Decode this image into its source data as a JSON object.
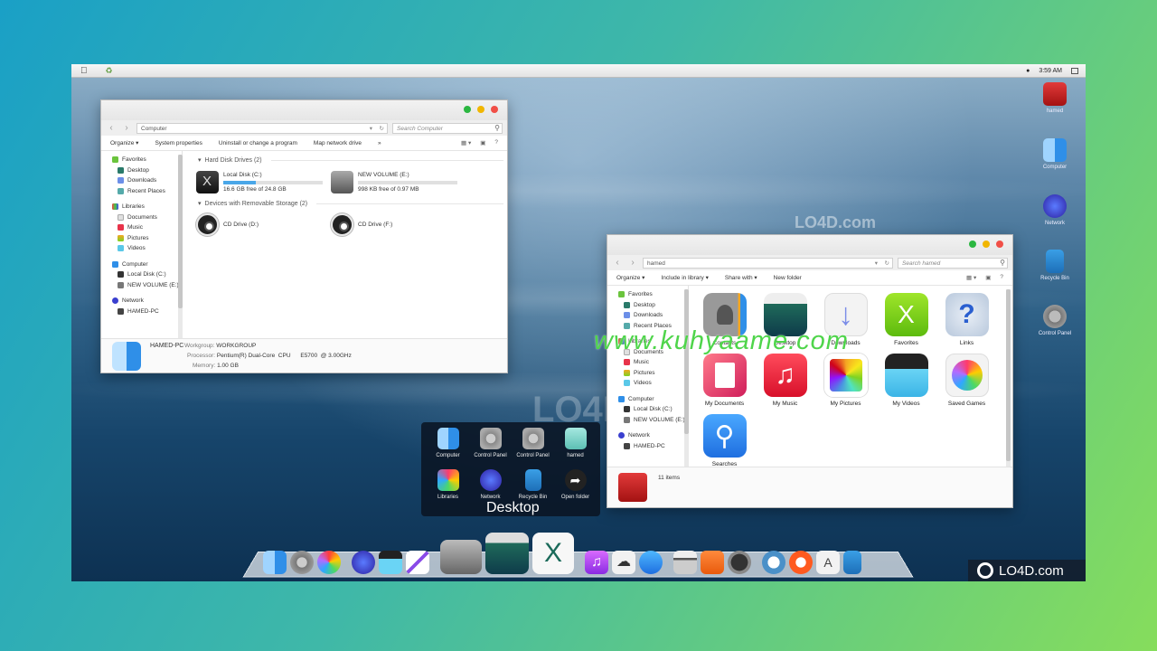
{
  "menubar": {
    "apple_icon": "apple-icon",
    "tray_icon": "recycle-icon",
    "clock": "3:59 AM"
  },
  "window_computer": {
    "address": "Computer",
    "search_placeholder": "Search Computer",
    "commands": [
      "Organize",
      "System properties",
      "Uninstall or change a program",
      "Map network drive"
    ],
    "more_commands": "»",
    "sidebar": {
      "favorites": "Favorites",
      "favorites_items": [
        "Desktop",
        "Downloads",
        "Recent Places"
      ],
      "libraries": "Libraries",
      "libraries_items": [
        "Documents",
        "Music",
        "Pictures",
        "Videos"
      ],
      "computer": "Computer",
      "computer_items": [
        "Local Disk (C:)",
        "NEW VOLUME (E:)"
      ],
      "network": "Network",
      "network_items": [
        "HAMED-PC"
      ]
    },
    "sections": {
      "hdd": "Hard Disk Drives (2)",
      "removable": "Devices with Removable Storage (2)"
    },
    "drives": [
      {
        "name": "Local Disk (C:)",
        "free": "16.6 GB free of 24.8 GB",
        "used_fraction": 0.33
      },
      {
        "name": "NEW VOLUME (E:)",
        "free": "998 KB free of 0.97 MB",
        "used_fraction": 0.0
      }
    ],
    "cd_drives": [
      "CD Drive (D:)",
      "CD Drive (F:)"
    ],
    "details": {
      "pc_name": "HAMED-PC",
      "workgroup_label": "Workgroup:",
      "workgroup": "WORKGROUP",
      "processor_label": "Processor:",
      "processor": "Pentium(R) Dual-Core  CPU      E5700  @ 3.00GHz",
      "memory_label": "Memory:",
      "memory": "1.00 GB"
    }
  },
  "window_hamed": {
    "address": "hamed",
    "search_placeholder": "Search hamed",
    "commands": [
      "Organize",
      "Include in library",
      "Share with",
      "New folder"
    ],
    "sidebar": {
      "favorites": "Favorites",
      "favorites_items": [
        "Desktop",
        "Downloads",
        "Recent Places"
      ],
      "libraries": "Libraries",
      "libraries_items": [
        "Documents",
        "Music",
        "Pictures",
        "Videos"
      ],
      "computer": "Computer",
      "computer_items": [
        "Local Disk (C:)",
        "NEW VOLUME (E:)"
      ],
      "network": "Network",
      "network_items": [
        "HAMED-PC"
      ]
    },
    "items": [
      "Contacts",
      "Desktop",
      "Downloads",
      "Favorites",
      "Links",
      "My Documents",
      "My Music",
      "My Pictures",
      "My Videos",
      "Saved Games",
      "Searches"
    ],
    "count": "11 items"
  },
  "watermark": "www.kuhyaame.com",
  "lo4d_watermark": "LO4D.com",
  "stack": {
    "label": "Desktop",
    "items": [
      "Computer",
      "Control Panel",
      "Control Panel",
      "hamed",
      "Libraries",
      "Network",
      "Recycle Bin",
      "Open folder"
    ]
  },
  "desktop_icons": [
    "hamed",
    "Computer",
    "Network",
    "Recycle Bin",
    "Control Panel"
  ],
  "dock": {
    "icons": [
      "finder-icon",
      "system-preferences-icon",
      "color-picker-icon",
      "network-globe-icon",
      "video-clapper-icon",
      "pen-icon",
      "hard-drive-icon",
      "desktop-stack-icon",
      "x-icon",
      "itunes-icon",
      "icloud-icon",
      "app-store-icon",
      "server-icon",
      "rocket-icon",
      "gauge-icon",
      "info-icon",
      "power-icon",
      "app-store-a-icon",
      "recycle-bin-icon"
    ]
  }
}
